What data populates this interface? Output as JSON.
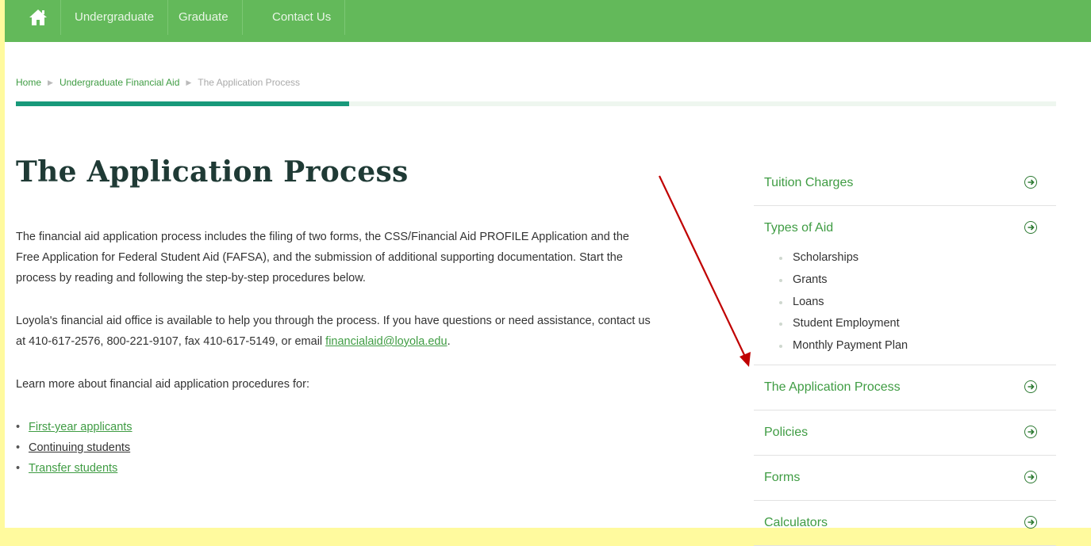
{
  "nav": {
    "home_icon": "home-icon",
    "items": [
      "Undergraduate",
      "Graduate",
      "Contact Us"
    ]
  },
  "breadcrumb": {
    "items": [
      "Home",
      "Undergraduate Financial Aid",
      "The Application Process"
    ],
    "progress": 0.32
  },
  "main": {
    "title": "The Application Process",
    "paragraph1": "The financial aid application process includes the filing of two forms, the CSS/Financial Aid PROFILE Application and the Free Application for Federal Student Aid (FAFSA), and the submission of additional supporting documentation. Start the process by reading and following the step-by-step procedures below.",
    "paragraph2_text": "Loyola's financial aid office is available to help you through the process. If you have questions or need assistance, contact us at 410-617-2576, 800-221-9107, fax 410-617-5149, or email",
    "paragraph2_email": "financialaid@loyola.edu",
    "paragraph2_end": ".",
    "paragraph3": "Learn more about financial aid application procedures for:",
    "links": [
      "First-year applicants",
      "Continuing students",
      "Transfer students"
    ]
  },
  "sidebar": {
    "items": [
      {
        "label": "Tuition Charges"
      },
      {
        "label": "Types of Aid",
        "children": [
          "Scholarships",
          "Grants",
          "Loans",
          "Student Employment",
          "Monthly Payment Plan"
        ]
      },
      {
        "label": "The Application Process"
      },
      {
        "label": "Policies"
      },
      {
        "label": "Forms"
      },
      {
        "label": "Calculators"
      }
    ]
  },
  "colors": {
    "nav_bg": "#63b95a",
    "accent_green": "#3f9c43",
    "progress_teal": "#18997a",
    "annotation_arrow": "#c00000",
    "margin_yellow": "#fffa9e"
  }
}
